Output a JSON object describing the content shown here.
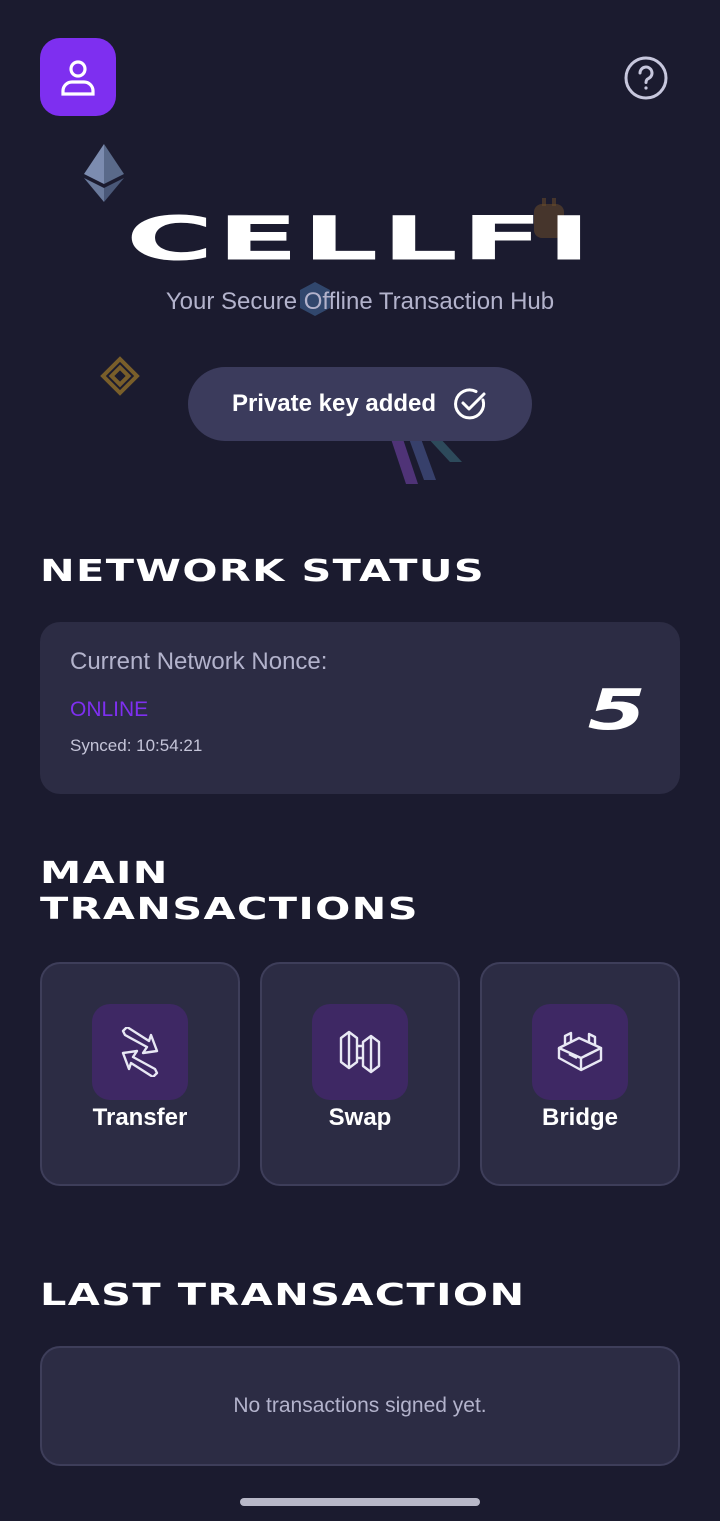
{
  "header": {
    "profile_icon": "user-icon",
    "help_icon": "question-circle-icon"
  },
  "brand": {
    "logo": "CELLFI",
    "tagline": "Your Secure Offline Transaction Hub"
  },
  "key_status": {
    "label": "Private key added",
    "icon": "check-circle-icon"
  },
  "network": {
    "title": "NETWORK STATUS",
    "nonce_label": "Current Network Nonce:",
    "status": "ONLINE",
    "synced": "Synced: 10:54:21",
    "nonce_value": "5"
  },
  "main": {
    "title": "MAIN\nTRANSACTIONS",
    "actions": [
      {
        "label": "Transfer",
        "icon": "transfer-arrows-icon"
      },
      {
        "label": "Swap",
        "icon": "swap-icon"
      },
      {
        "label": "Bridge",
        "icon": "bridge-icon"
      }
    ]
  },
  "last_transaction": {
    "title": "LAST TRANSACTION",
    "empty_text": "No transactions signed yet."
  },
  "colors": {
    "background": "#1b1b2f",
    "card": "#2c2c44",
    "accent": "#7e2ff0",
    "pill": "#3b3b5c",
    "icon_box": "#3e2864"
  }
}
